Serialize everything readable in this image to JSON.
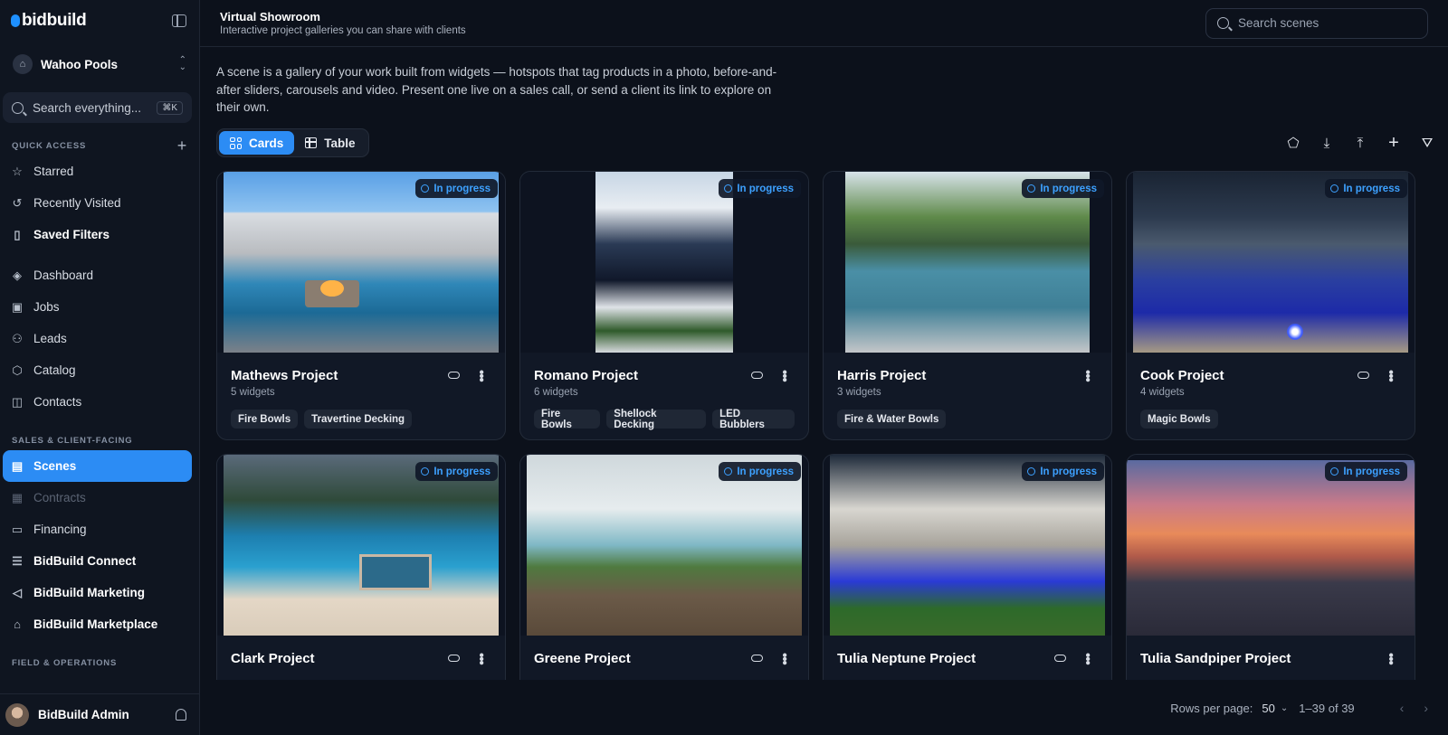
{
  "app": {
    "logo_text": "bidbuild",
    "org_name": "Wahoo Pools",
    "org_initial": "⌂"
  },
  "sidebar": {
    "search_placeholder": "Search everything...",
    "search_shortcut": "⌘K",
    "quick_access_label": "QUICK ACCESS",
    "quick_items": [
      {
        "label": "Starred",
        "icon": "☆"
      },
      {
        "label": "Recently Visited",
        "icon": "↺"
      },
      {
        "label": "Saved Filters",
        "icon": "▯"
      }
    ],
    "main_items": [
      {
        "label": "Dashboard",
        "icon": "◈"
      },
      {
        "label": "Jobs",
        "icon": "▣"
      },
      {
        "label": "Leads",
        "icon": "⚇"
      },
      {
        "label": "Catalog",
        "icon": "⬡"
      },
      {
        "label": "Contacts",
        "icon": "◫"
      }
    ],
    "sales_label": "SALES & CLIENT-FACING",
    "sales_items": [
      {
        "label": "Scenes",
        "icon": "▤"
      },
      {
        "label": "Contracts",
        "icon": "▦"
      },
      {
        "label": "Financing",
        "icon": "▭"
      },
      {
        "label": "BidBuild Connect",
        "icon": "☰"
      },
      {
        "label": "BidBuild Marketing",
        "icon": "◁"
      },
      {
        "label": "BidBuild Marketplace",
        "icon": "⌂"
      }
    ],
    "field_label": "FIELD & OPERATIONS",
    "user_name": "BidBuild Admin"
  },
  "header": {
    "title": "Virtual Showroom",
    "subtitle": "Interactive project galleries you can share with clients",
    "search_placeholder": "Search scenes"
  },
  "intro": "A scene is a gallery of your work built from widgets — hotspots that tag products in a photo, before-and-after sliders, carousels and video. Present one live on a sales call, or send a client its link to explore on their own.",
  "view_toggle": {
    "cards_label": "Cards",
    "table_label": "Table",
    "selected": "Cards"
  },
  "toolbar_icons": [
    "tag-icon",
    "download-icon",
    "upload-icon",
    "plus-icon",
    "filter-icon"
  ],
  "cards": [
    {
      "title": "Mathews Project",
      "widgets": "5 widgets",
      "status": "In progress",
      "tags": [
        "Fire Bowls",
        "Travertine Decking"
      ],
      "has_link": true
    },
    {
      "title": "Romano Project",
      "widgets": "6 widgets",
      "status": "In progress",
      "tags": [
        "Fire Bowls",
        "Shellock Decking",
        "LED Bubblers"
      ],
      "has_link": true
    },
    {
      "title": "Harris Project",
      "widgets": "3 widgets",
      "status": "In progress",
      "tags": [
        "Fire & Water Bowls"
      ],
      "has_link": false
    },
    {
      "title": "Cook Project",
      "widgets": "4 widgets",
      "status": "In progress",
      "tags": [
        "Magic Bowls"
      ],
      "has_link": true
    },
    {
      "title": "Clark Project",
      "widgets": "",
      "status": "In progress",
      "tags": [],
      "has_link": true
    },
    {
      "title": "Greene Project",
      "widgets": "",
      "status": "In progress",
      "tags": [],
      "has_link": true
    },
    {
      "title": "Tulia Neptune Project",
      "widgets": "",
      "status": "In progress",
      "tags": [],
      "has_link": true
    },
    {
      "title": "Tulia Sandpiper Project",
      "widgets": "",
      "status": "In progress",
      "tags": [],
      "has_link": false
    }
  ],
  "pagination": {
    "rows_per_page_label": "Rows per page:",
    "rows_per_page_value": "50",
    "range": "1–39 of 39"
  },
  "colors": {
    "accent": "#2c8cf4",
    "badge_text": "#3da1ff",
    "background": "#0c111b"
  }
}
